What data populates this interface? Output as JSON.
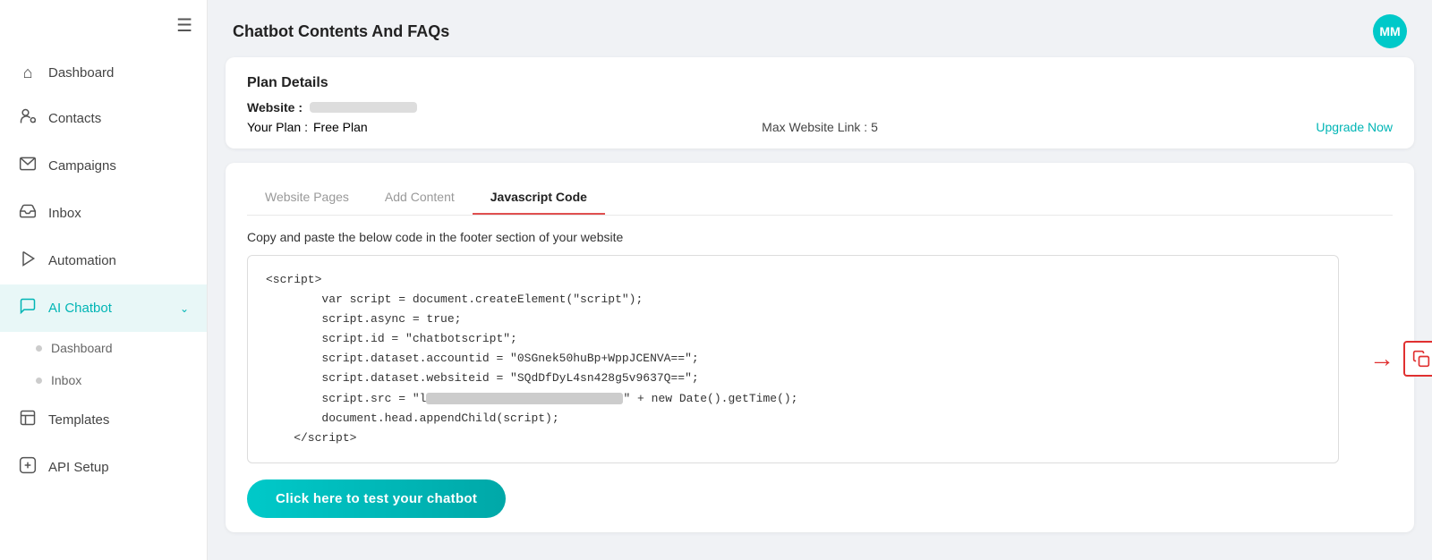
{
  "sidebar": {
    "hamburger_icon": "≡",
    "items": [
      {
        "id": "dashboard",
        "label": "Dashboard",
        "icon": "⌂"
      },
      {
        "id": "contacts",
        "label": "Contacts",
        "icon": "☺"
      },
      {
        "id": "campaigns",
        "label": "Campaigns",
        "icon": "✉"
      },
      {
        "id": "inbox",
        "label": "Inbox",
        "icon": "✉"
      },
      {
        "id": "automation",
        "label": "Automation",
        "icon": "✂"
      },
      {
        "id": "ai-chatbot",
        "label": "AI Chatbot",
        "icon": "💬",
        "has_chevron": true,
        "active": true
      },
      {
        "id": "templates",
        "label": "Templates",
        "icon": "☰"
      },
      {
        "id": "api-setup",
        "label": "API Setup",
        "icon": "⬡"
      }
    ],
    "sub_items": [
      {
        "id": "chatbot-dashboard",
        "label": "Dashboard"
      },
      {
        "id": "chatbot-inbox",
        "label": "Inbox"
      }
    ]
  },
  "header": {
    "title": "Chatbot Contents And FAQs",
    "avatar_initials": "MM"
  },
  "plan_details": {
    "title": "Plan Details",
    "website_label": "Website",
    "plan_label": "Your Plan",
    "plan_value": "Free Plan",
    "max_link_label": "Max Website Link",
    "max_link_value": "5",
    "upgrade_label": "Upgrade Now"
  },
  "tabs": [
    {
      "id": "website-pages",
      "label": "Website Pages",
      "active": false
    },
    {
      "id": "add-content",
      "label": "Add Content",
      "active": false
    },
    {
      "id": "javascript-code",
      "label": "Javascript Code",
      "active": true
    }
  ],
  "code_section": {
    "description": "Copy and paste the below code in the footer section of your website",
    "code_lines": [
      "<script>",
      "        var script = document.createElement(\"script\");",
      "        script.async = true;",
      "        script.id = \"chatbotscript\";",
      "        script.dataset.accountid = \"0SGnek50huBp+WppJCENVA==\";",
      "        script.dataset.websiteid = \"SQdDfDyL4sn428g5v9637Q==\";",
      "        script.src = \"l[BLURRED]\" + new Date().getTime();",
      "        document.head.appendChild(script);",
      "<\\/script>"
    ],
    "copy_tooltip": "Copy code",
    "test_button_label": "Click here to test your chatbot"
  },
  "colors": {
    "accent": "#00c9c9",
    "tab_active_border": "#e05050",
    "copy_border": "#e03030",
    "arrow_color": "#e03030",
    "upgrade_color": "#00b5b5"
  }
}
